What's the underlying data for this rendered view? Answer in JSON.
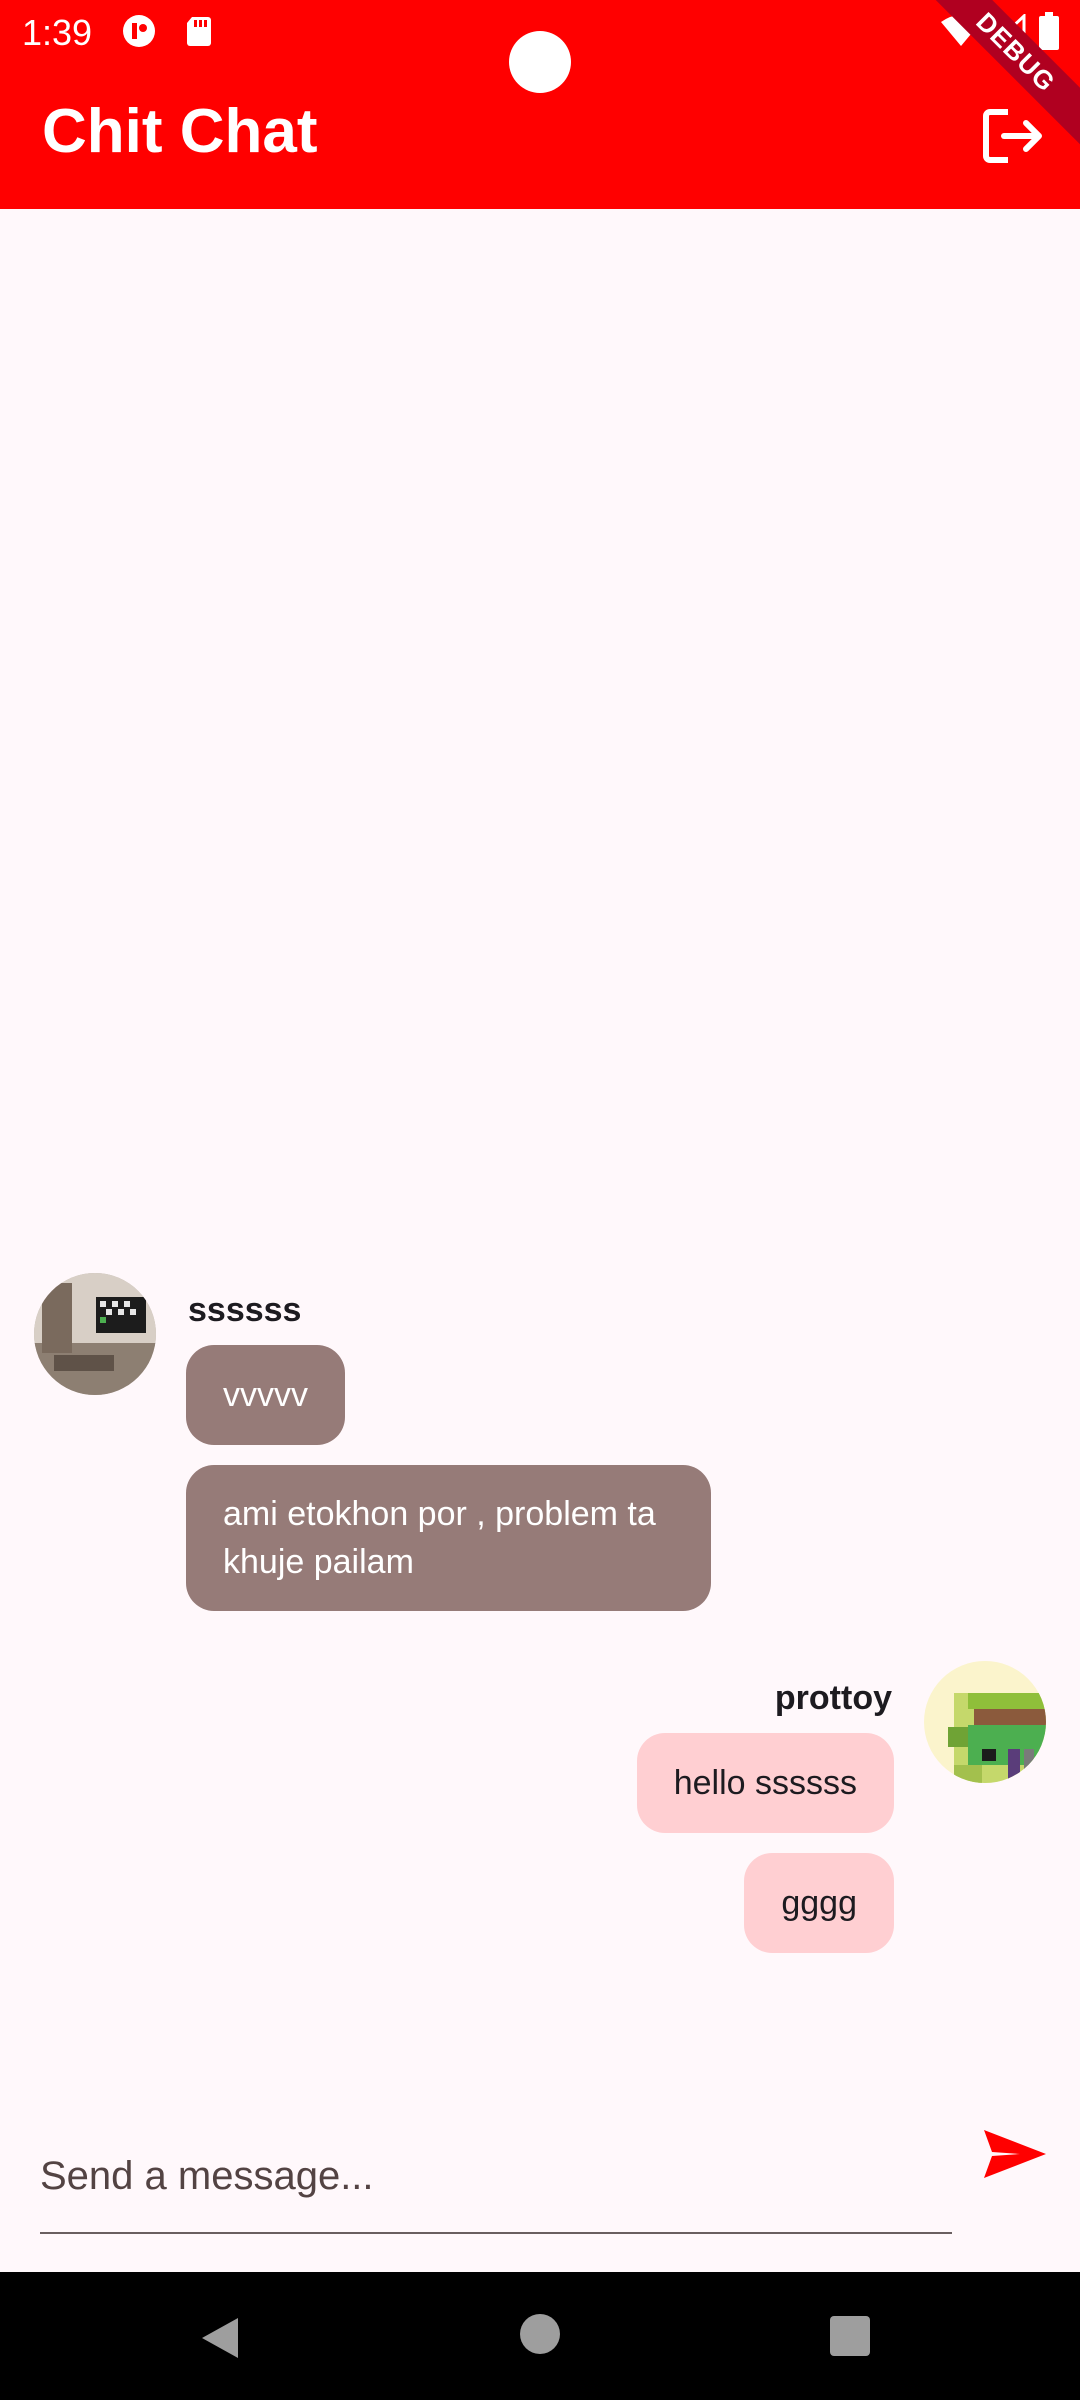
{
  "status_bar": {
    "time": "1:39"
  },
  "app_bar": {
    "title": "Chit Chat",
    "debug_label": "DEBUG",
    "logout_icon": "logout-icon",
    "color": "#ff0000"
  },
  "messages": {
    "other": {
      "sender": "ssssss",
      "texts": [
        "vvvvv",
        "ami etokhon por , problem ta khuje pailam"
      ],
      "bubble_color": "#967b78"
    },
    "mine": {
      "sender": "prottoy",
      "texts": [
        "hello ssssss",
        "gggg"
      ],
      "bubble_color": "#ffcfd2"
    }
  },
  "composer": {
    "placeholder": "Send a message...",
    "value": "",
    "send_icon": "send-icon"
  }
}
